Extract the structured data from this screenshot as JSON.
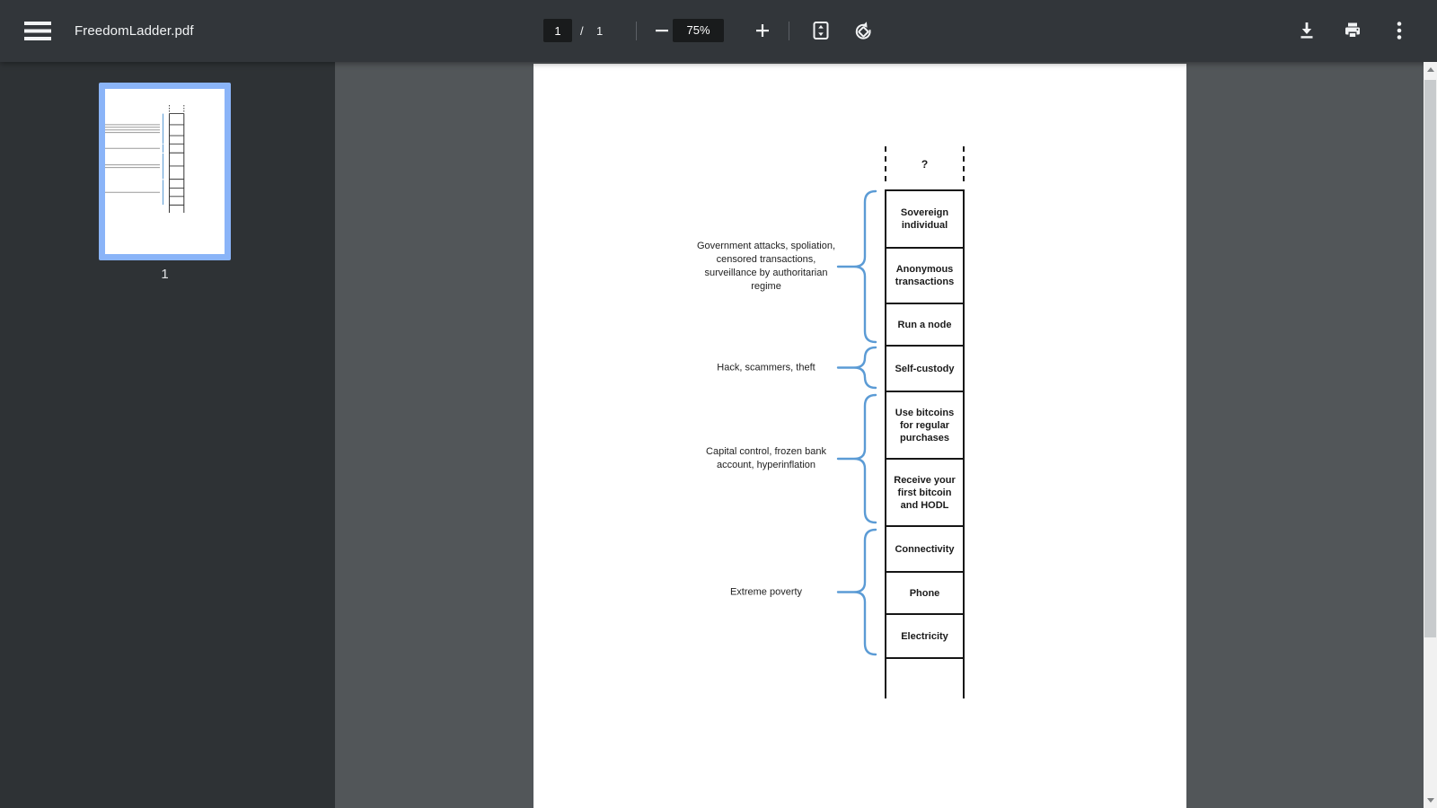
{
  "toolbar": {
    "title": "FreedomLadder.pdf",
    "page_input": "1",
    "page_separator": "/",
    "page_count": "1",
    "zoom_value": "75%"
  },
  "sidebar": {
    "page_number": "1"
  },
  "ladder": {
    "question": "?",
    "rungs": [
      "Sovereign individual",
      "Anonymous transactions",
      "Run a node",
      "Self-custody",
      "Use bitcoins for regular purchases",
      "Receive your first bitcoin and HODL",
      "Connectivity",
      "Phone",
      "Electricity"
    ],
    "braces": [
      "Government attacks, spoliation, censored transactions, surveillance by authoritarian regime",
      "Hack, scammers, theft",
      "Capital control, frozen bank account, hyperinflation",
      "Extreme poverty"
    ]
  },
  "icons": {
    "menu": "hamburger",
    "zoom_out": "minus",
    "zoom_in": "plus",
    "fit": "fit-to-page",
    "rotate": "rotate-counterclockwise",
    "download": "download-arrow",
    "print": "printer",
    "more": "kebab-vertical"
  },
  "colors": {
    "brace_blue": "#5b9bd5",
    "selection_blue": "#8ab4f8"
  }
}
